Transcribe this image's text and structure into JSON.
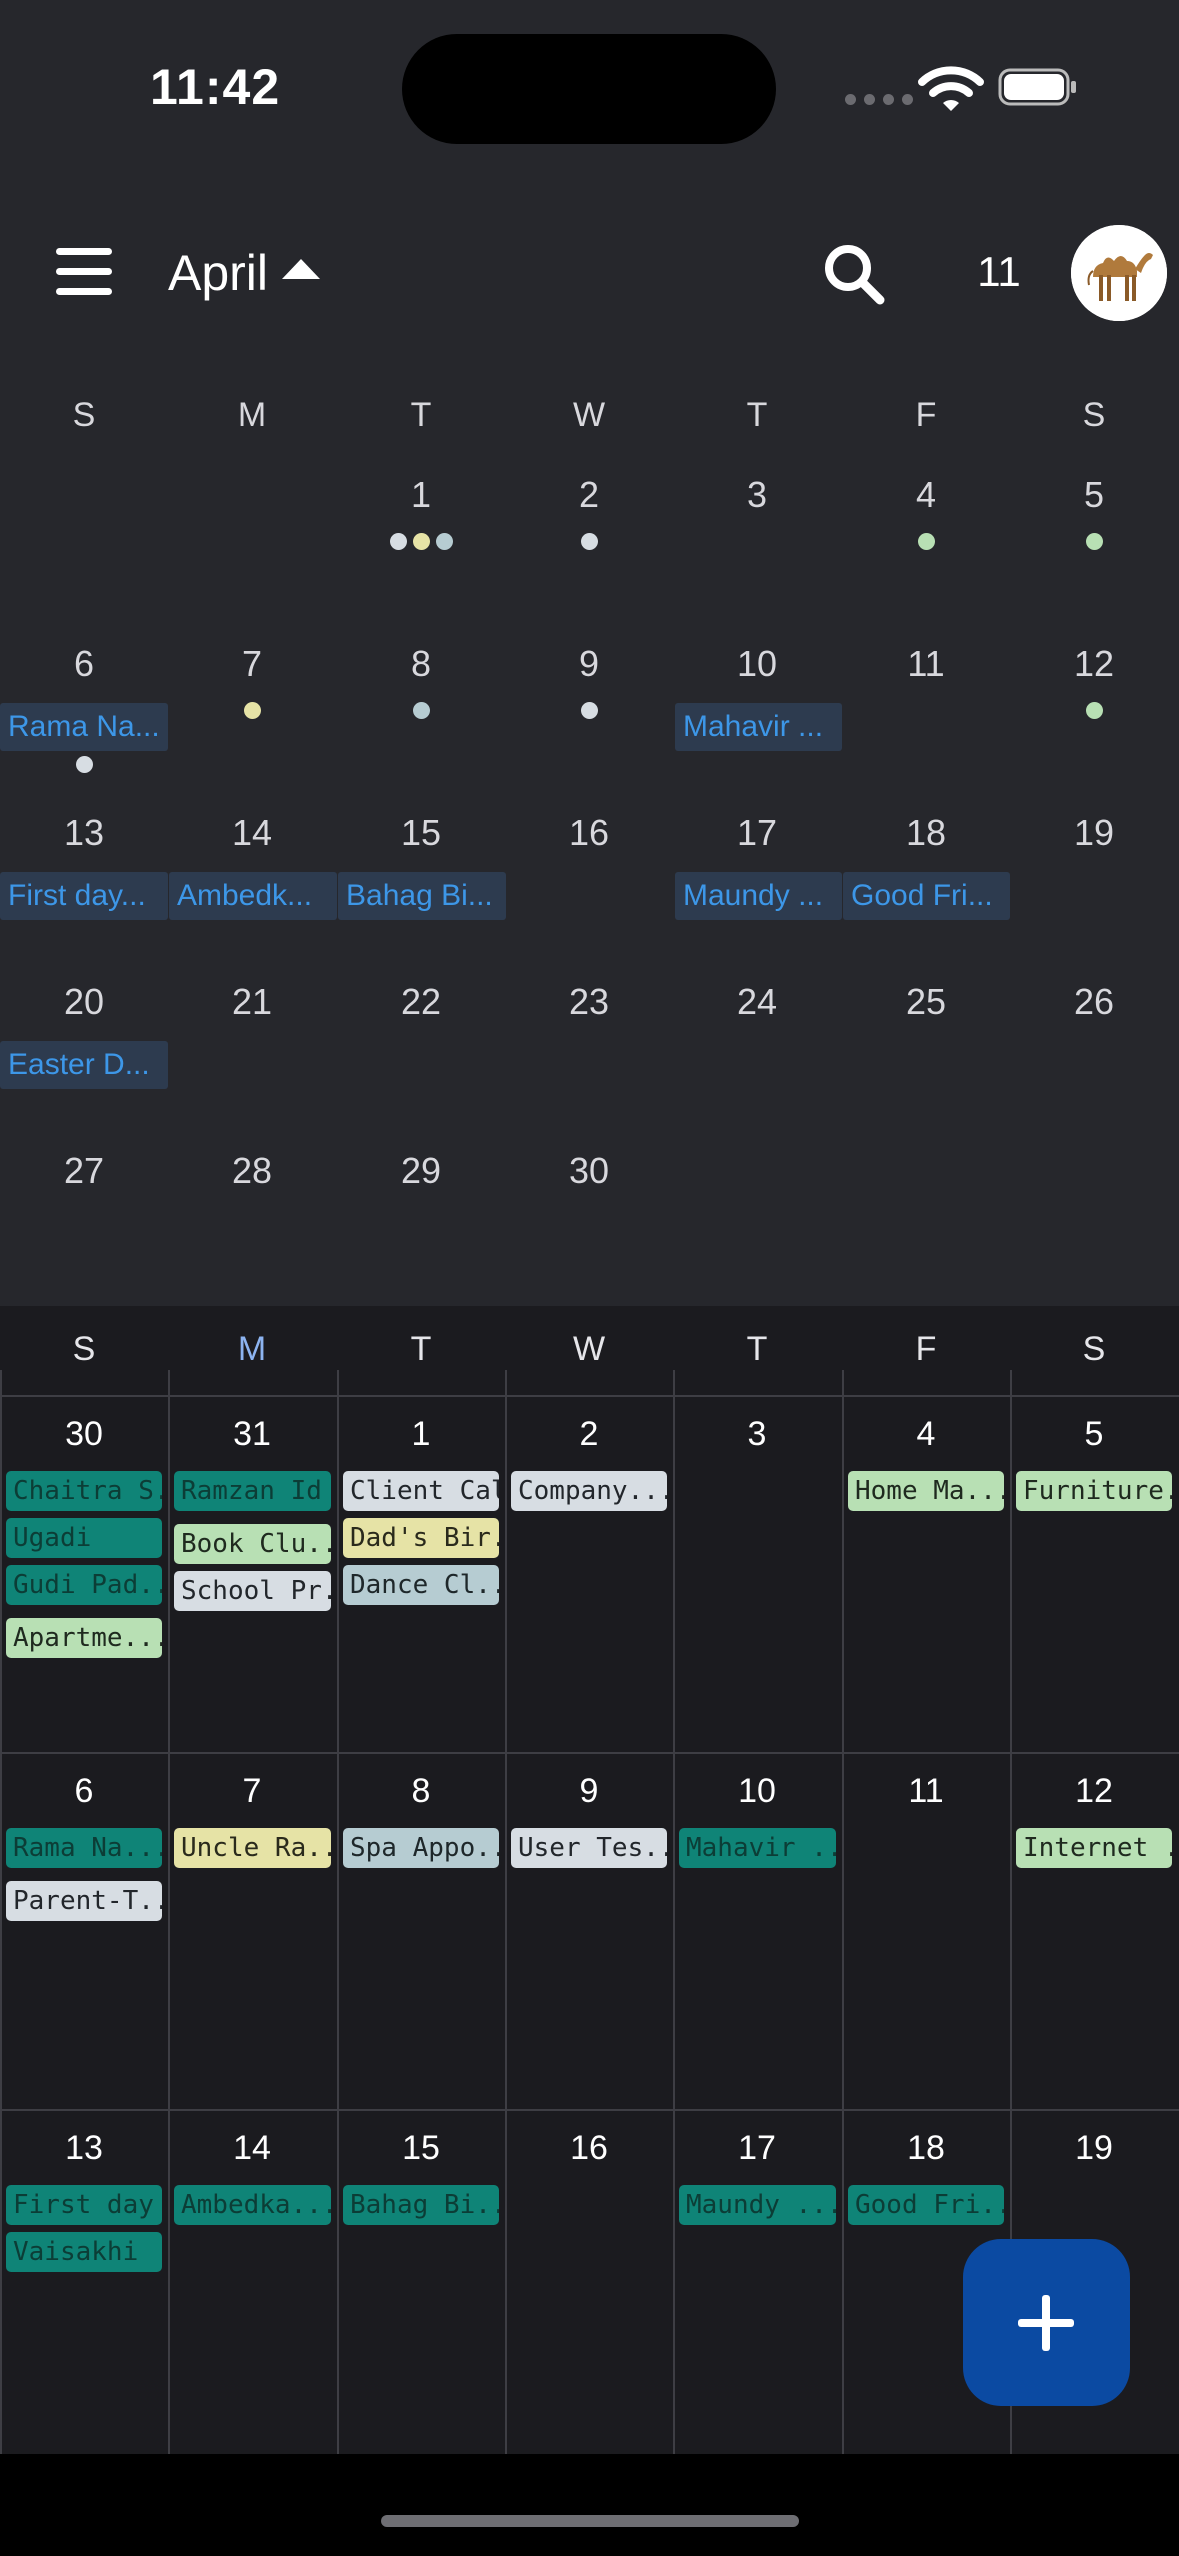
{
  "status_bar": {
    "time": "11:42"
  },
  "header": {
    "month": "April",
    "today": "11"
  },
  "colors": {
    "holiday_text": "#3d97e8",
    "holiday_bg": "#2d3b4f",
    "teal": "#0f8477",
    "light_green": "#b8e0b4",
    "light_gray": "#d7dde3",
    "pale_yellow": "#e6e3a6",
    "blue_gray": "#b6ccd2",
    "fab": "#0b4aa2",
    "highlight_weekday": "#8db4f0"
  },
  "weekdays": [
    "S",
    "M",
    "T",
    "W",
    "T",
    "F",
    "S"
  ],
  "month_view": {
    "days": [
      [
        "",
        "",
        "1",
        "2",
        "3",
        "4",
        "5"
      ],
      [
        "6",
        "7",
        "8",
        "9",
        "10",
        "11",
        "12"
      ],
      [
        "13",
        "14",
        "15",
        "16",
        "17",
        "18",
        "19"
      ],
      [
        "20",
        "21",
        "22",
        "23",
        "24",
        "25",
        "26"
      ],
      [
        "27",
        "28",
        "29",
        "30",
        "",
        "",
        ""
      ]
    ],
    "holidays": [
      "Rama Na...",
      "Mahavir ...",
      "First day...",
      "Ambedk...",
      "Bahag Bi...",
      "Maundy ...",
      "Good Fri...",
      "Easter D..."
    ]
  },
  "week_view": {
    "weeks": [
      {
        "days": [
          "30",
          "31",
          "1",
          "2",
          "3",
          "4",
          "5"
        ],
        "events": [
          [
            "Chaitra S...",
            "Ugadi",
            "Gudi Pad...",
            "Apartme..."
          ],
          [
            "Ramzan Id",
            "Book Clu...",
            "School Pr..."
          ],
          [
            "Client Call",
            "Dad's Bir...",
            "Dance Cl..."
          ],
          [
            "Company..."
          ],
          [],
          [
            "Home Ma..."
          ],
          [
            "Furniture..."
          ]
        ]
      },
      {
        "days": [
          "6",
          "7",
          "8",
          "9",
          "10",
          "11",
          "12"
        ],
        "events": [
          [
            "Rama Na...",
            "Parent-T..."
          ],
          [
            "Uncle Ra..."
          ],
          [
            "Spa Appo..."
          ],
          [
            "User Tes..."
          ],
          [
            "Mahavir ..."
          ],
          [],
          [
            "Internet ..."
          ]
        ]
      },
      {
        "days": [
          "13",
          "14",
          "15",
          "16",
          "17",
          "18",
          "19"
        ],
        "events": [
          [
            "First day ...",
            "Vaisakhi"
          ],
          [
            "Ambedka..."
          ],
          [
            "Bahag Bi..."
          ],
          [],
          [
            "Maundy ..."
          ],
          [
            "Good Fri..."
          ],
          []
        ]
      }
    ]
  }
}
